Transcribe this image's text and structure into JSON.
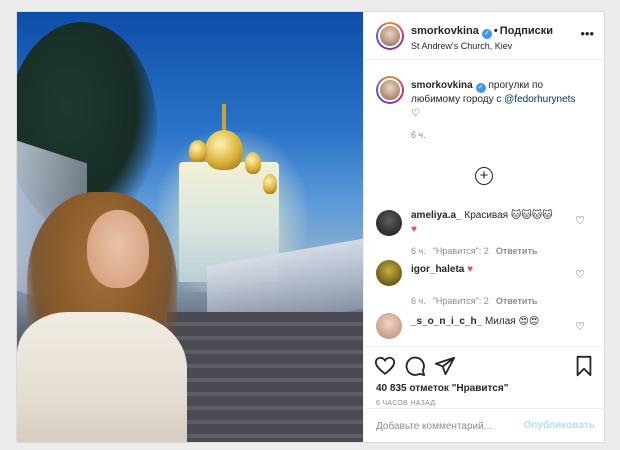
{
  "post": {
    "author": {
      "username": "smorkovkina",
      "verified": true,
      "follow_label": "Подписки",
      "location": "St Andrew's Church, Kiev"
    },
    "photo": {
      "description": ""
    },
    "caption": {
      "username": "smorkovkina",
      "text_before": "прогулки по любимому городу с ",
      "mention": "@fedorhurynets",
      "text_after": "♡",
      "time": "6 ч."
    },
    "comments": [
      {
        "username": "ameliya.a_",
        "text": "Красивая",
        "emoji": "🐱🐱🐱🐱",
        "heart": "♥",
        "time": "6 ч.",
        "likes": "\"Нравится\": 2",
        "reply": "Ответить"
      },
      {
        "username": "igor_haleta",
        "text": "",
        "emoji": "",
        "heart": "♥",
        "time": "6 ч.",
        "likes": "\"Нравится\": 2",
        "reply": "Ответить"
      },
      {
        "username": "_s_o_n_i_c_h_",
        "text": "Милая",
        "emoji": "😍😍",
        "heart": "",
        "time": "",
        "likes": "",
        "reply": ""
      }
    ],
    "actions": {
      "likes_count": "40 835 отметок \"Нравится\"",
      "time_ago": "6 ЧАСОВ НАЗАД"
    },
    "add_comment": {
      "placeholder": "Добавьте комментарий...",
      "publish_label": "Опубликовать"
    },
    "icons": [
      "more-icon",
      "heart-icon",
      "comment-icon",
      "share-icon",
      "bookmark-icon",
      "load-more-icon",
      "verified-icon"
    ],
    "colors": {
      "verified": "#3897f0",
      "heart": "#ed4956",
      "publish_disabled": "#b2dffc",
      "mention": "#00376b"
    }
  }
}
